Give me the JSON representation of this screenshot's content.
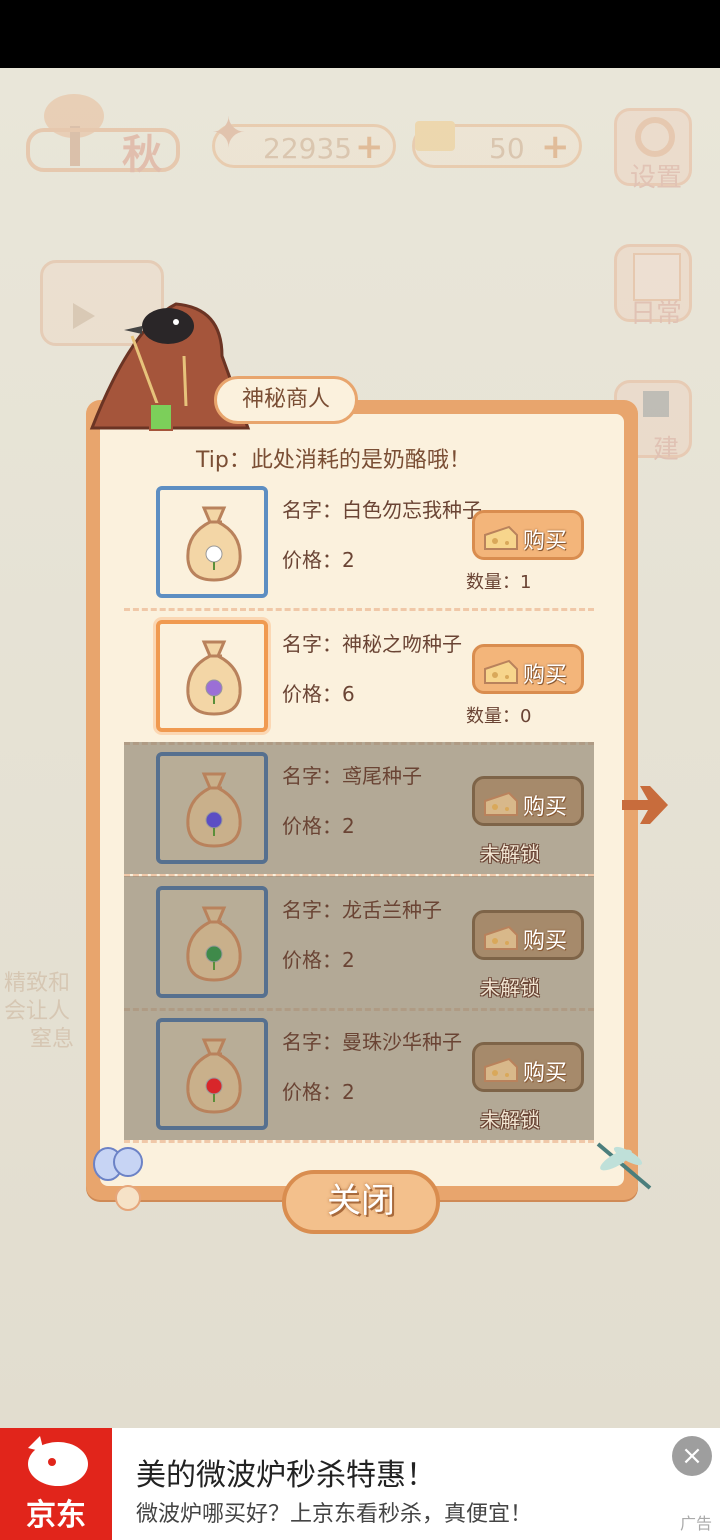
{
  "hud": {
    "season": "秋",
    "fish_count": "22935",
    "cheese_count": "50",
    "settings_label": "设置",
    "daily_label": "日常",
    "build_label": "建"
  },
  "background_text": {
    "left_line1": "精致和",
    "left_line2": "会让人",
    "left_line3": "窒息"
  },
  "shop": {
    "title": "神秘商人",
    "tip": "Tip：此处消耗的是奶酪哦！",
    "buy_label": "购买",
    "close_label": "关闭",
    "items": [
      {
        "name": "名字：白色勿忘我种子",
        "price": "价格：2",
        "status": "数量：1",
        "locked": false,
        "flower_color": "#ffffff"
      },
      {
        "name": "名字：神秘之吻种子",
        "price": "价格：6",
        "status": "数量：0",
        "locked": false,
        "flower_color": "#9b6fd6"
      },
      {
        "name": "名字：鸢尾种子",
        "price": "价格：2",
        "status": "未解锁",
        "locked": true,
        "flower_color": "#5b4ec4"
      },
      {
        "name": "名字：龙舌兰种子",
        "price": "价格：2",
        "status": "未解锁",
        "locked": true,
        "flower_color": "#3f8a4a"
      },
      {
        "name": "名字：曼珠沙华种子",
        "price": "价格：2",
        "status": "未解锁",
        "locked": true,
        "flower_color": "#d8262a"
      }
    ]
  },
  "ad": {
    "brand": "京东",
    "title": "美的微波炉秒杀特惠！",
    "subtitle": "微波炉哪买好？上京东看秒杀，真便宜！",
    "tag": "广告",
    "close_icon": "×"
  }
}
